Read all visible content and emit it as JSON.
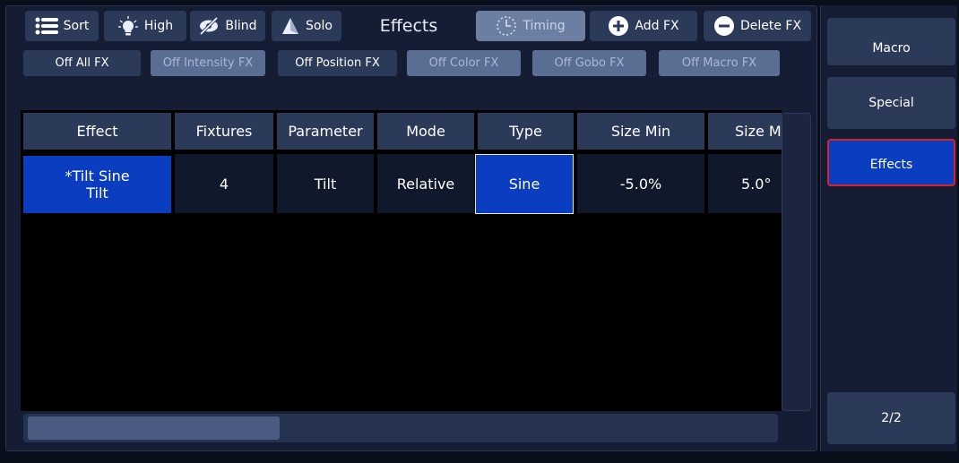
{
  "toolbar": {
    "sort_label": "Sort",
    "high_label": "High",
    "blind_label": "Blind",
    "solo_label": "Solo",
    "title": "Effects",
    "timing_label": "Timing",
    "add_fx_label": "Add FX",
    "delete_fx_label": "Delete FX"
  },
  "fx_filters": [
    {
      "label": "Off All FX"
    },
    {
      "label": "Off Intensity FX"
    },
    {
      "label": "Off Position FX"
    },
    {
      "label": "Off Color FX"
    },
    {
      "label": "Off Gobo FX"
    },
    {
      "label": "Off Macro FX"
    }
  ],
  "table": {
    "headers": [
      "Effect",
      "Fixtures",
      "Parameter",
      "Mode",
      "Type",
      "Size Min",
      "Size M"
    ],
    "rows": [
      {
        "effect_line1": "*Tilt Sine",
        "effect_line2": "Tilt",
        "fixtures": "4",
        "parameter": "Tilt",
        "mode": "Relative",
        "type": "Sine",
        "size_min": "-5.0%",
        "size_max": "5.0°"
      }
    ]
  },
  "sidebar": {
    "items": [
      {
        "label": "Macro"
      },
      {
        "label": "Special"
      },
      {
        "label": "Effects"
      }
    ],
    "page_label": "2/2"
  },
  "colors": {
    "accent_blue": "#0a3dbf",
    "active_border": "#d8222a",
    "button_bg": "#2b3a58",
    "panel_bg": "#141d34"
  },
  "icons": [
    "list-icon",
    "bulb-icon",
    "eye-slash-icon",
    "solo-icon",
    "timing-icon",
    "plus-circle-icon",
    "minus-circle-icon"
  ]
}
